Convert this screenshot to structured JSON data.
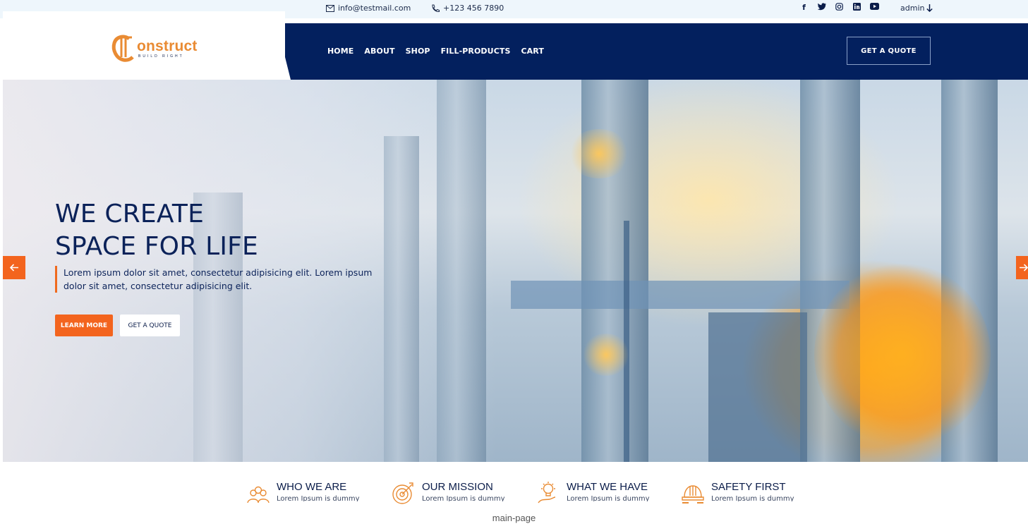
{
  "topbar": {
    "email": "info@testmail.com",
    "phone": "+123 456 7890",
    "socials": [
      "facebook-icon",
      "twitter-icon",
      "instagram-icon",
      "linkedin-icon",
      "youtube-icon"
    ],
    "admin": "admin"
  },
  "logo": {
    "word": "onstruct",
    "tagline": "BUILD RIGHT"
  },
  "nav": {
    "items": [
      "HOME",
      "ABOUT",
      "SHOP",
      "FILL-PRODUCTS",
      "CART"
    ],
    "quote": "GET A QUOTE"
  },
  "hero": {
    "title_line1": "WE CREATE",
    "title_line2": "SPACE FOR LIFE",
    "text": "Lorem ipsum dolor sit amet, consectetur adipisicing elit. Lorem ipsum dolor sit amet, consectetur adipisicing elit.",
    "learn_more": "LEARN MORE",
    "get_quote": "GET A QUOTE"
  },
  "features": [
    {
      "title": "WHO WE ARE",
      "text": "Lorem Ipsum is dummy",
      "icon": "team-icon"
    },
    {
      "title": "OUR MISSION",
      "text": "Lorem Ipsum is dummy",
      "icon": "target-icon"
    },
    {
      "title": "WHAT WE HAVE",
      "text": "Lorem Ipsum is dummy",
      "icon": "idea-icon"
    },
    {
      "title": "SAFETY FIRST",
      "text": "Lorem Ipsum is dummy",
      "icon": "helmet-icon"
    }
  ],
  "footer_label": "main-page",
  "colors": {
    "navy": "#03205e",
    "accent": "#f3641e",
    "logo": "#e98b33"
  }
}
